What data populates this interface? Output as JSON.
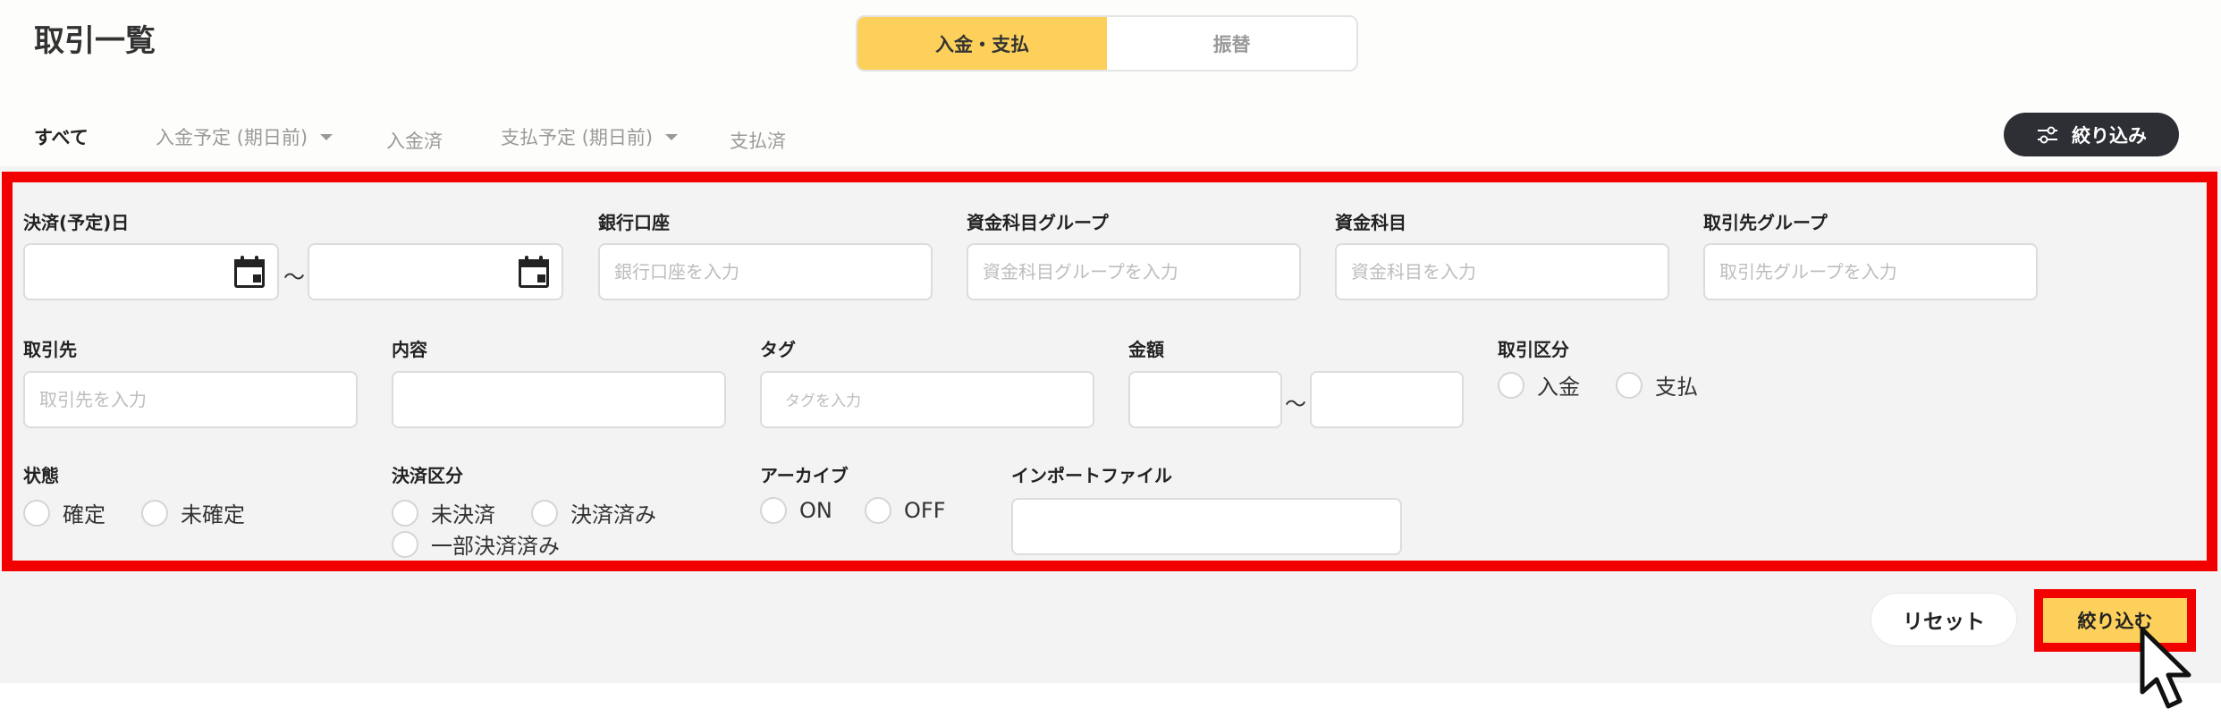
{
  "page": {
    "title": "取引一覧"
  },
  "segment": {
    "options": [
      "入金・支払",
      "振替"
    ],
    "selected": "入金・支払"
  },
  "tabs": [
    {
      "label": "すべて",
      "active": true,
      "dropdown": false
    },
    {
      "label": "入金予定 (期日前)",
      "active": false,
      "dropdown": true
    },
    {
      "label": "入金済",
      "active": false,
      "dropdown": false
    },
    {
      "label": "支払予定 (期日前)",
      "active": false,
      "dropdown": true
    },
    {
      "label": "支払済",
      "active": false,
      "dropdown": false
    }
  ],
  "filter_toggle": {
    "label": "絞り込み",
    "icon": "sliders-icon"
  },
  "filters": {
    "settlement_date": {
      "label": "決済(予定)日",
      "from": "",
      "to": "",
      "separator": "〜",
      "icon": "calendar-icon"
    },
    "bank_account": {
      "label": "銀行口座",
      "placeholder": "銀行口座を入力"
    },
    "fund_item_group": {
      "label": "資金科目グループ",
      "placeholder": "資金科目グループを入力"
    },
    "fund_item": {
      "label": "資金科目",
      "placeholder": "資金科目を入力"
    },
    "partner_group": {
      "label": "取引先グループ",
      "placeholder": "取引先グループを入力"
    },
    "partner": {
      "label": "取引先",
      "placeholder": "取引先を入力"
    },
    "content": {
      "label": "内容",
      "value": ""
    },
    "tag": {
      "label": "タグ",
      "placeholder": "タグを入力"
    },
    "amount": {
      "label": "金額",
      "from": "",
      "to": "",
      "separator": "〜"
    },
    "transaction_type": {
      "label": "取引区分",
      "options": [
        "入金",
        "支払"
      ]
    },
    "status": {
      "label": "状態",
      "options": [
        "確定",
        "未確定"
      ]
    },
    "settlement_type": {
      "label": "決済区分",
      "options": [
        "未決済",
        "決済済み",
        "一部決済済み"
      ]
    },
    "archive": {
      "label": "アーカイブ",
      "options": [
        "ON",
        "OFF"
      ]
    },
    "import_file": {
      "label": "インポートファイル",
      "value": ""
    }
  },
  "actions": {
    "reset_label": "リセット",
    "apply_label": "絞り込む"
  },
  "colors": {
    "accent": "#fcd05a",
    "highlight": "#f20000",
    "dark_button": "#2d2f34"
  }
}
